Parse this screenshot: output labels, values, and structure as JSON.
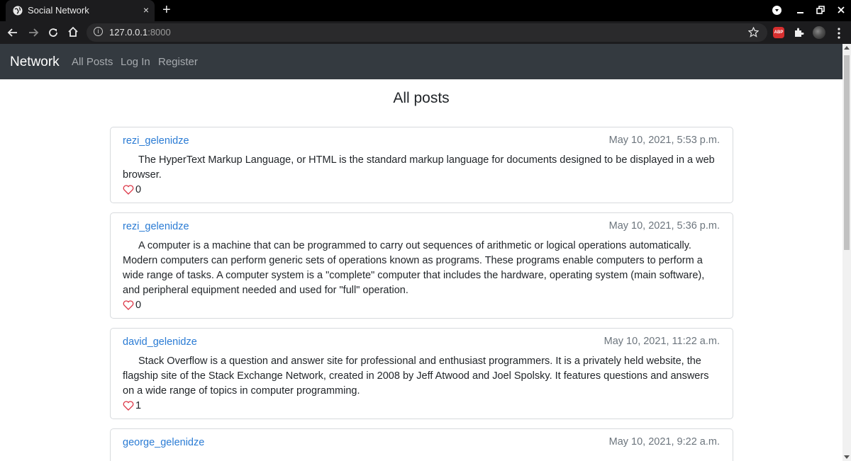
{
  "browser": {
    "tab_title": "Social Network",
    "tab_close": "×",
    "new_tab": "+",
    "url_host": "127.0.0.1",
    "url_port": ":8000",
    "abp_label": "ABP",
    "icons": [
      "globe-icon",
      "back-icon",
      "forward-icon",
      "reload-icon",
      "home-icon",
      "info-icon",
      "star-icon",
      "adblock-icon",
      "extensions-icon",
      "profile-avatar",
      "menu-icon"
    ]
  },
  "navbar": {
    "brand": "Network",
    "links": [
      "All Posts",
      "Log In",
      "Register"
    ],
    "bg_color": "#343a40"
  },
  "main": {
    "heading": "All posts",
    "posts": [
      {
        "author": "rezi_gelenidze",
        "timestamp": "May 10, 2021, 5:53 p.m.",
        "body": "The HyperText Markup Language, or HTML is the standard markup language for documents designed to be displayed in a web browser.",
        "likes": "0"
      },
      {
        "author": "rezi_gelenidze",
        "timestamp": "May 10, 2021, 5:36 p.m.",
        "body": "A computer is a machine that can be programmed to carry out sequences of arithmetic or logical operations automatically. Modern computers can perform generic sets of operations known as programs. These programs enable computers to perform a wide range of tasks. A computer system is a \"complete\" computer that includes the hardware, operating system (main software), and peripheral equipment needed and used for \"full\" operation.",
        "likes": "0"
      },
      {
        "author": "david_gelenidze",
        "timestamp": "May 10, 2021, 11:22 a.m.",
        "body": "Stack Overflow is a question and answer site for professional and enthusiast programmers. It is a privately held website, the flagship site of the Stack Exchange Network, created in 2008 by Jeff Atwood and Joel Spolsky. It features questions and answers on a wide range of topics in computer programming.",
        "likes": "1"
      },
      {
        "author": "george_gelenidze",
        "timestamp": "May 10, 2021, 9:22 a.m.",
        "body": "",
        "likes": ""
      }
    ]
  },
  "colors": {
    "link": "#2a7bd4",
    "heart": "#dc3545"
  }
}
